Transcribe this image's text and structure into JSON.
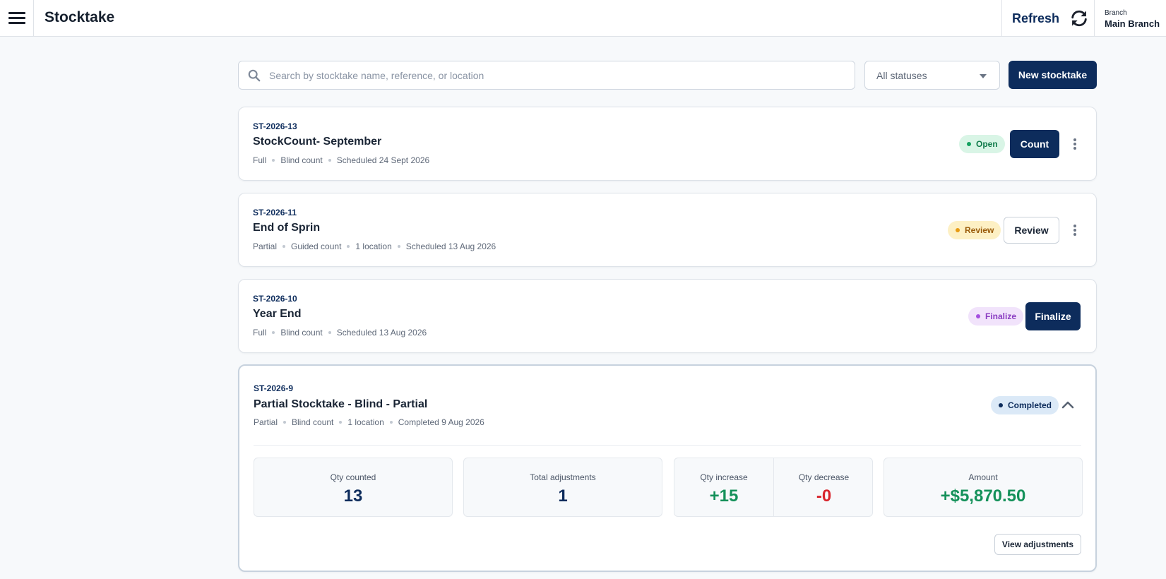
{
  "header": {
    "menu_icon": "hamburger-menu-icon",
    "title": "Stocktake",
    "refresh_label": "Refresh",
    "refresh_icon": "refresh-icon",
    "branch_label": "Branch",
    "branch_name": "Main Branch"
  },
  "toolbar": {
    "search_placeholder": "Search by stocktake name, reference, or location",
    "search_icon": "search-icon",
    "status_filter": "All statuses",
    "new_button": "New stocktake"
  },
  "stocktakes": [
    {
      "ref": "ST-2026-13",
      "name": "StockCount- September",
      "meta": [
        "Full",
        "Blind count",
        "Scheduled 24 Sept 2026"
      ],
      "status": "Open",
      "action": "Count"
    },
    {
      "ref": "ST-2026-11",
      "name": "End of Sprin",
      "meta": [
        "Partial",
        "Guided count",
        "1 location",
        "Scheduled 13 Aug 2026"
      ],
      "status": "Review",
      "action": "Review"
    },
    {
      "ref": "ST-2026-10",
      "name": "Year End",
      "meta": [
        "Full",
        "Blind count",
        "Scheduled 13 Aug 2026"
      ],
      "status": "Finalize",
      "action": "Finalize"
    },
    {
      "ref": "ST-2026-9",
      "name": "Partial Stocktake - Blind - Partial",
      "meta": [
        "Partial",
        "Blind count",
        "1 location",
        "Completed 9 Aug 2026"
      ],
      "status": "Completed",
      "summary": {
        "qty_counted_label": "Qty counted",
        "qty_counted": "13",
        "total_adjustments_label": "Total adjustments",
        "total_adjustments": "1",
        "qty_increase_label": "Qty increase",
        "qty_increase": "+15",
        "qty_decrease_label": "Qty decrease",
        "qty_decrease": "-0",
        "amount_label": "Amount",
        "amount": "+$5,870.50"
      },
      "view_adjustments": "View adjustments"
    }
  ],
  "colors": {
    "primary": "#0d2c5c",
    "open": "#14a15f",
    "review": "#e79b13",
    "finalize": "#a54fe0",
    "increase": "#14915a",
    "decrease": "#d8242c"
  }
}
